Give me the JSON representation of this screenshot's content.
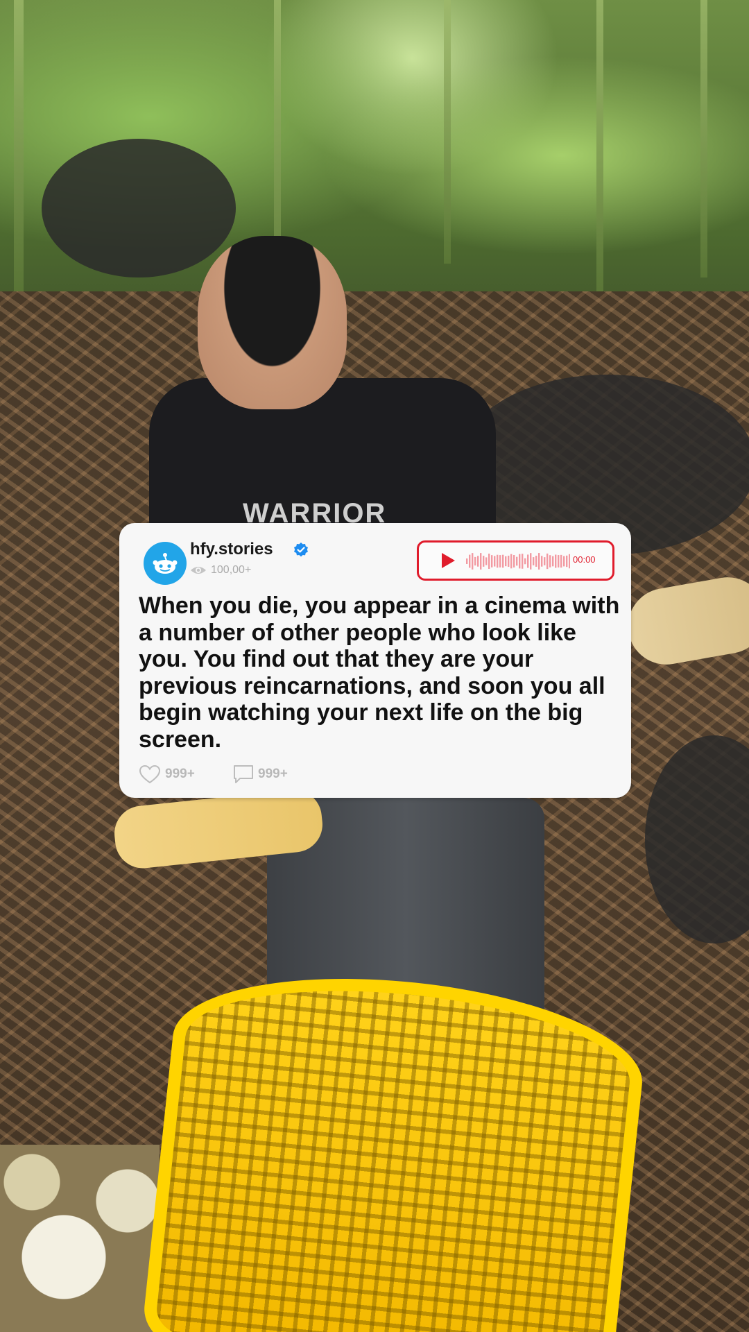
{
  "post": {
    "username": "hfy.stories",
    "views": "100,00+",
    "audio_time": "00:00",
    "body": "When you die, you appear in a cinema with a number of other people who look like you. You find out that they are your previous reincarnations, and soon you all begin watching your next life on the big screen.",
    "likes": "999+",
    "comments": "999+"
  },
  "background": {
    "shirt_text": "WARRIOR"
  },
  "colors": {
    "accent_red": "#e01c2c",
    "avatar_blue": "#22a5e8",
    "verified_blue": "#1d8cf0",
    "card_bg": "#f7f7f7"
  },
  "icons": {
    "avatar": "reddit-snoo-icon",
    "verified": "verified-badge-icon",
    "views": "eye-icon",
    "audio": "play-icon",
    "likes": "heart-icon",
    "comments": "comment-icon"
  }
}
